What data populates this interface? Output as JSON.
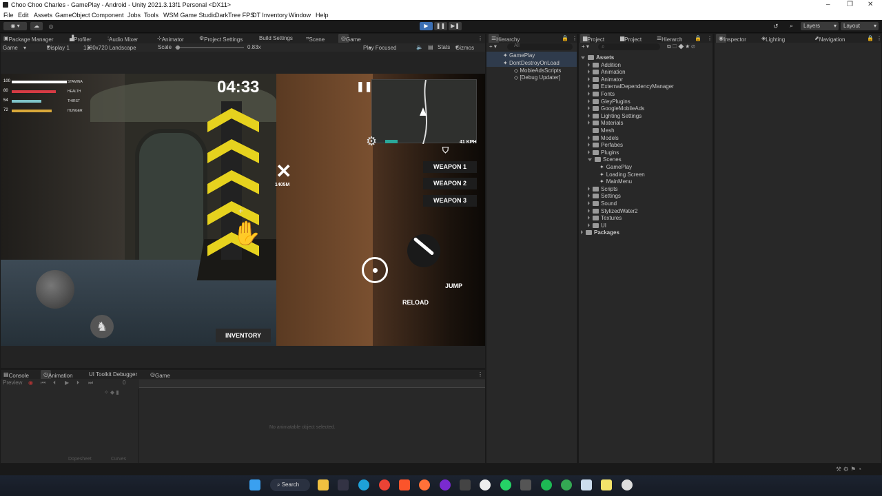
{
  "window": {
    "title": "Choo Choo Charles - GamePlay - Android - Unity 2021.3.13f1 Personal <DX11>"
  },
  "menu": [
    "File",
    "Edit",
    "Assets",
    "GameObject",
    "Component",
    "Jobs",
    "Tools",
    "WSM Game Studio",
    "DarkTree FPS",
    "DT Inventory",
    "Window",
    "Help"
  ],
  "toolbar": {
    "layers": "Layers",
    "layout": "Layout"
  },
  "game_tabs": [
    "Package Manager",
    "Profiler",
    "Audio Mixer",
    "Animator",
    "Project Settings",
    "Build Settings",
    "Scene",
    "Game"
  ],
  "game_options": {
    "view": "Game",
    "display": "Display 1",
    "resolution": "1280x720 Landscape",
    "scale_label": "Scale",
    "scale_value": "0.83x",
    "play_mode": "Play Focused",
    "stats": "Stats",
    "gizmos": "Gizmos"
  },
  "hud": {
    "timer": "04:33",
    "stats": [
      {
        "value": "100",
        "label": "STAMINA",
        "fill": 1.0,
        "color": "#ffffff"
      },
      {
        "value": "80",
        "label": "HEALTH",
        "fill": 0.8,
        "color": "#d63b44"
      },
      {
        "value": "54",
        "label": "THIRST",
        "fill": 0.54,
        "color": "#7fc4c8"
      },
      {
        "value": "72",
        "label": "HUNGER",
        "fill": 0.72,
        "color": "#d9a83a"
      }
    ],
    "marker_distance": "1405M",
    "speed": "41 KPH",
    "weapons": [
      "WEAPON 1",
      "WEAPON 2",
      "WEAPON 3"
    ],
    "jump": "JUMP",
    "reload": "RELOAD",
    "inventory": "INVENTORY"
  },
  "hierarchy": {
    "tab": "Hierarchy",
    "search_placeholder": "All",
    "items": [
      "GamePlay",
      "DontDestroyOnLoad",
      "MobieAdsScripts",
      "[Debug Updater]"
    ]
  },
  "project": {
    "tabs": [
      "Project",
      "Project",
      "Hierarch"
    ],
    "root": "Assets",
    "folders": [
      "Addition",
      "Animation",
      "Animator",
      "ExternalDependencyManager",
      "Fonts",
      "GleyPlugins",
      "GoogleMobileAds",
      "Lighting Settings",
      "Materials",
      "Mesh",
      "Models",
      "Perfabes",
      "Plugins",
      "Scenes",
      "GamePlay",
      "Loading Screen",
      "MainMenu",
      "Scripts",
      "Settings",
      "Sound",
      "StylizedWater2",
      "Textures",
      "UI"
    ],
    "packages": "Packages"
  },
  "inspector_tabs": [
    "Inspector",
    "Lighting",
    "Navigation"
  ],
  "bottom": {
    "tabs": [
      "Console",
      "Animation",
      "UI Toolkit Debugger",
      "Game"
    ],
    "preview": "Preview",
    "ruler_start": "0",
    "empty_message": "No animatable object selected.",
    "dopesheet": "Dopesheet",
    "curves": "Curves"
  },
  "taskbar": {
    "search": "Search"
  }
}
